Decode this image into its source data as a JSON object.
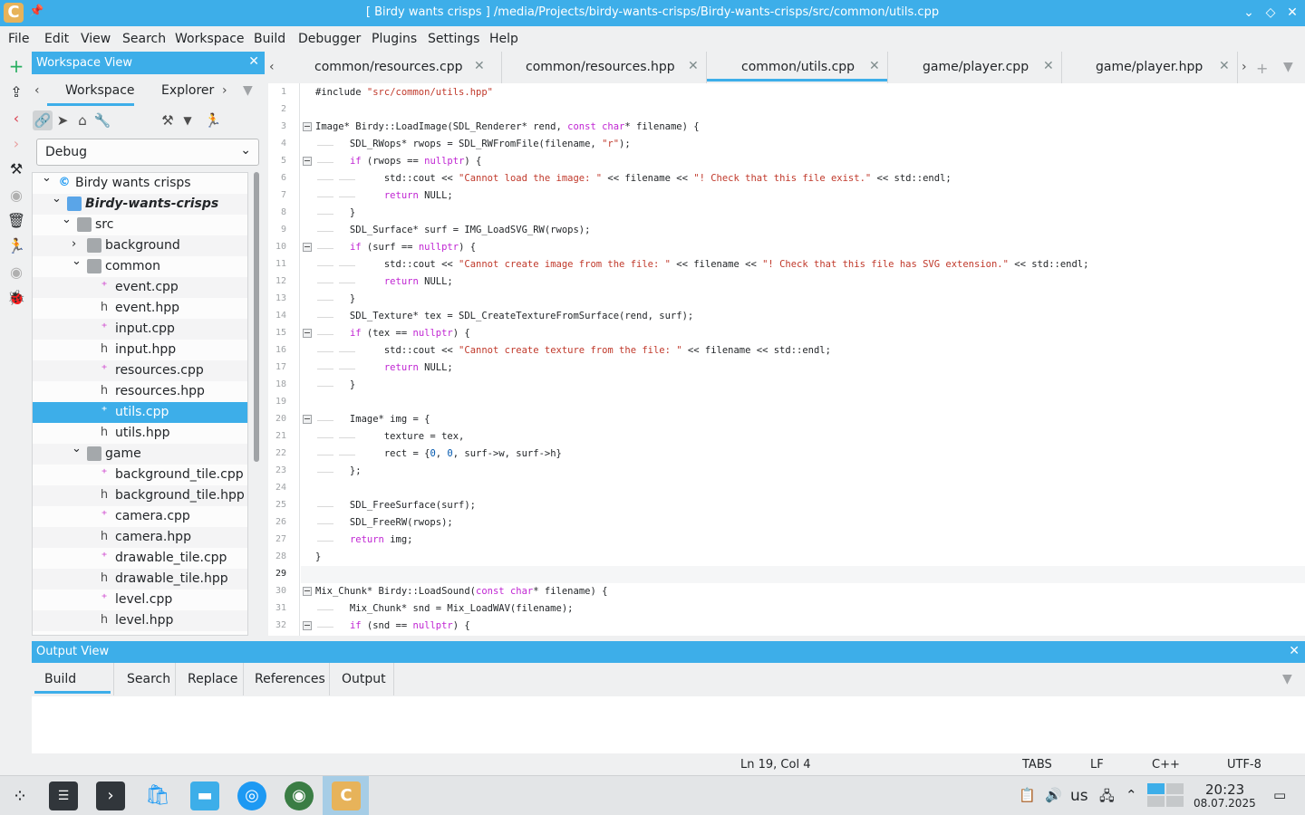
{
  "window": {
    "title": "[ Birdy wants crisps ] /media/Projects/birdy-wants-crisps/Birdy-wants-crisps/src/common/utils.cpp",
    "app_icon": "C"
  },
  "menu": [
    "File",
    "Edit",
    "View",
    "Search",
    "Workspace",
    "Build",
    "Debugger",
    "Plugins",
    "Settings",
    "Help"
  ],
  "workspace": {
    "title": "Workspace View",
    "tabs": [
      "Workspace",
      "Explorer"
    ],
    "config": "Debug",
    "tree": [
      {
        "label": "Birdy wants crisps",
        "type": "workspace",
        "arrow": "⌄",
        "level": 0
      },
      {
        "label": "Birdy-wants-crisps",
        "type": "project",
        "arrow": "⌄",
        "level": 1
      },
      {
        "label": "src",
        "type": "folder",
        "arrow": "⌄",
        "level": 2
      },
      {
        "label": "background",
        "type": "folder",
        "arrow": "›",
        "level": 3
      },
      {
        "label": "common",
        "type": "folder",
        "arrow": "⌄",
        "level": 3
      },
      {
        "label": "event.cpp",
        "type": "cpp",
        "level": 4
      },
      {
        "label": "event.hpp",
        "type": "hpp",
        "level": 4
      },
      {
        "label": "input.cpp",
        "type": "cpp",
        "level": 4
      },
      {
        "label": "input.hpp",
        "type": "hpp",
        "level": 4
      },
      {
        "label": "resources.cpp",
        "type": "cpp",
        "level": 4
      },
      {
        "label": "resources.hpp",
        "type": "hpp",
        "level": 4
      },
      {
        "label": "utils.cpp",
        "type": "cpp",
        "level": 4,
        "selected": true
      },
      {
        "label": "utils.hpp",
        "type": "hpp",
        "level": 4
      },
      {
        "label": "game",
        "type": "folder",
        "arrow": "⌄",
        "level": 3
      },
      {
        "label": "background_tile.cpp",
        "type": "cpp",
        "level": 4
      },
      {
        "label": "background_tile.hpp",
        "type": "hpp",
        "level": 4
      },
      {
        "label": "camera.cpp",
        "type": "cpp",
        "level": 4
      },
      {
        "label": "camera.hpp",
        "type": "hpp",
        "level": 4
      },
      {
        "label": "drawable_tile.cpp",
        "type": "cpp",
        "level": 4
      },
      {
        "label": "drawable_tile.hpp",
        "type": "hpp",
        "level": 4
      },
      {
        "label": "level.cpp",
        "type": "cpp",
        "level": 4
      },
      {
        "label": "level.hpp",
        "type": "hpp",
        "level": 4
      }
    ]
  },
  "editor_tabs": [
    {
      "label": "common/resources.cpp",
      "active": false
    },
    {
      "label": "common/resources.hpp",
      "active": false
    },
    {
      "label": "common/utils.cpp",
      "active": true
    },
    {
      "label": "game/player.cpp",
      "active": false
    },
    {
      "label": "game/player.hpp",
      "active": false
    }
  ],
  "editor": {
    "current_line": 29,
    "lines": [
      "#include \"src/common/utils.hpp\"",
      "",
      "Image* Birdy::LoadImage(SDL_Renderer* rend, const char* filename) {",
      "    SDL_RWops* rwops = SDL_RWFromFile(filename, \"r\");",
      "    if (rwops == nullptr) {",
      "        std::cout << \"Cannot load the image: \" << filename << \"! Check that this file exist.\" << std::endl;",
      "        return NULL;",
      "    }",
      "    SDL_Surface* surf = IMG_LoadSVG_RW(rwops);",
      "    if (surf == nullptr) {",
      "        std::cout << \"Cannot create image from the file: \" << filename << \"! Check that this file has SVG extension.\" << std::endl;",
      "        return NULL;",
      "    }",
      "    SDL_Texture* tex = SDL_CreateTextureFromSurface(rend, surf);",
      "    if (tex == nullptr) {",
      "        std::cout << \"Cannot create texture from the file: \" << filename << std::endl;",
      "        return NULL;",
      "    }",
      "",
      "    Image* img = {",
      "        texture = tex,",
      "        rect = {0, 0, surf->w, surf->h}",
      "    };",
      "",
      "    SDL_FreeSurface(surf);",
      "    SDL_FreeRW(rwops);",
      "    return img;",
      "}",
      "",
      "Mix_Chunk* Birdy::LoadSound(const char* filename) {",
      "    Mix_Chunk* snd = Mix_LoadWAV(filename);",
      "    if (snd == nullptr) {"
    ],
    "fold_lines": [
      3,
      5,
      10,
      15,
      20,
      30,
      32
    ]
  },
  "output": {
    "title": "Output View",
    "tabs": [
      "Build",
      "Search",
      "Replace",
      "References",
      "Output"
    ]
  },
  "status": {
    "position": "Ln 19, Col 4",
    "indent": "TABS",
    "eol": "LF",
    "lang": "C++",
    "encoding": "UTF-8"
  },
  "taskbar": {
    "layout": "us",
    "time": "20:23",
    "date": "08.07.2025"
  },
  "colors": {
    "accent": "#3daee9",
    "keyword": "#c026d3",
    "string": "#c0392b",
    "number": "#0057ae"
  }
}
